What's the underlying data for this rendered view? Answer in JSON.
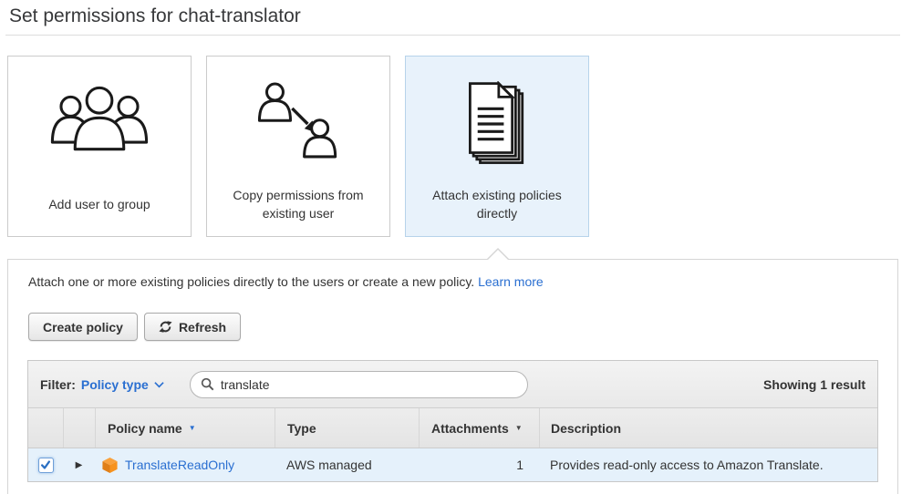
{
  "page": {
    "title": "Set permissions for chat-translator"
  },
  "permission_options": {
    "cards": [
      {
        "label": "Add user to group",
        "selected": false
      },
      {
        "label": "Copy permissions from existing user",
        "selected": false
      },
      {
        "label": "Attach existing policies directly",
        "selected": true
      }
    ]
  },
  "attach_panel": {
    "intro_text": "Attach one or more existing policies directly to the users or create a new policy.",
    "learn_more_label": "Learn more",
    "create_policy_label": "Create policy",
    "refresh_label": "Refresh",
    "filter_bar": {
      "filter_label": "Filter:",
      "filter_type_label": "Policy type",
      "search_value": "translate",
      "results_summary": "Showing 1 result"
    },
    "table": {
      "headers": {
        "policy_name": "Policy name",
        "type": "Type",
        "attachments": "Attachments",
        "description": "Description"
      },
      "rows": [
        {
          "checked": true,
          "policy_name": "TranslateReadOnly",
          "type": "AWS managed",
          "attachments": "1",
          "description": "Provides read-only access to Amazon Translate."
        }
      ]
    }
  },
  "icons": {
    "sort_arrow": "▼",
    "expand_arrow": "▶"
  },
  "colors": {
    "link_blue": "#2a6fd1",
    "selected_card_bg": "#e8f2fb",
    "selected_card_border": "#b7d3ea",
    "selected_row_bg": "#e5f1fb",
    "policy_cube_orange": "#f7931e",
    "checkbox_blue": "#2a6fc2"
  }
}
